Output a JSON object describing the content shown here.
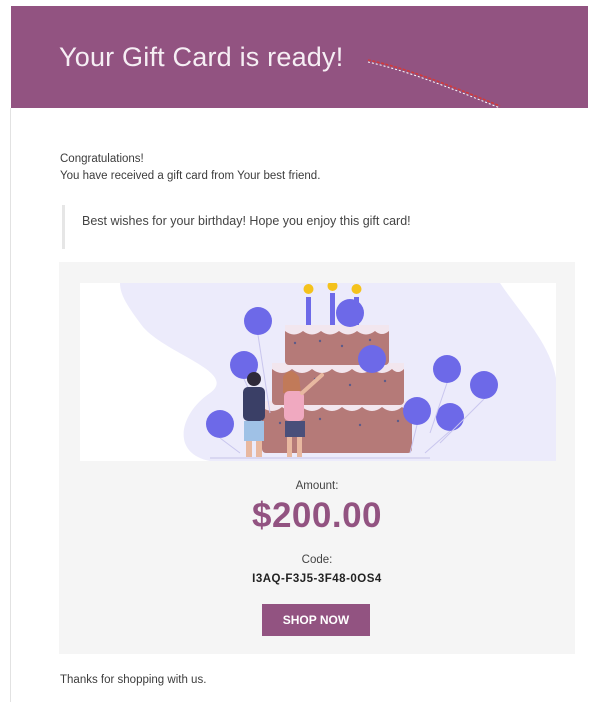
{
  "header": {
    "title": "Your Gift Card is ready!",
    "bg_color": "#925381"
  },
  "greeting": {
    "line1": "Congratulations!",
    "line2": "You have received a gift card from Your best friend."
  },
  "message": "Best wishes for your birthday! Hope you enjoy this gift card!",
  "card": {
    "amount_label": "Amount:",
    "amount": "$200.00",
    "code_label": "Code:",
    "code": "I3AQ-F3J5-3F48-0OS4",
    "button_label": "SHOP NOW",
    "accent_color": "#925381"
  },
  "footer": {
    "thanks": "Thanks for shopping with us."
  }
}
